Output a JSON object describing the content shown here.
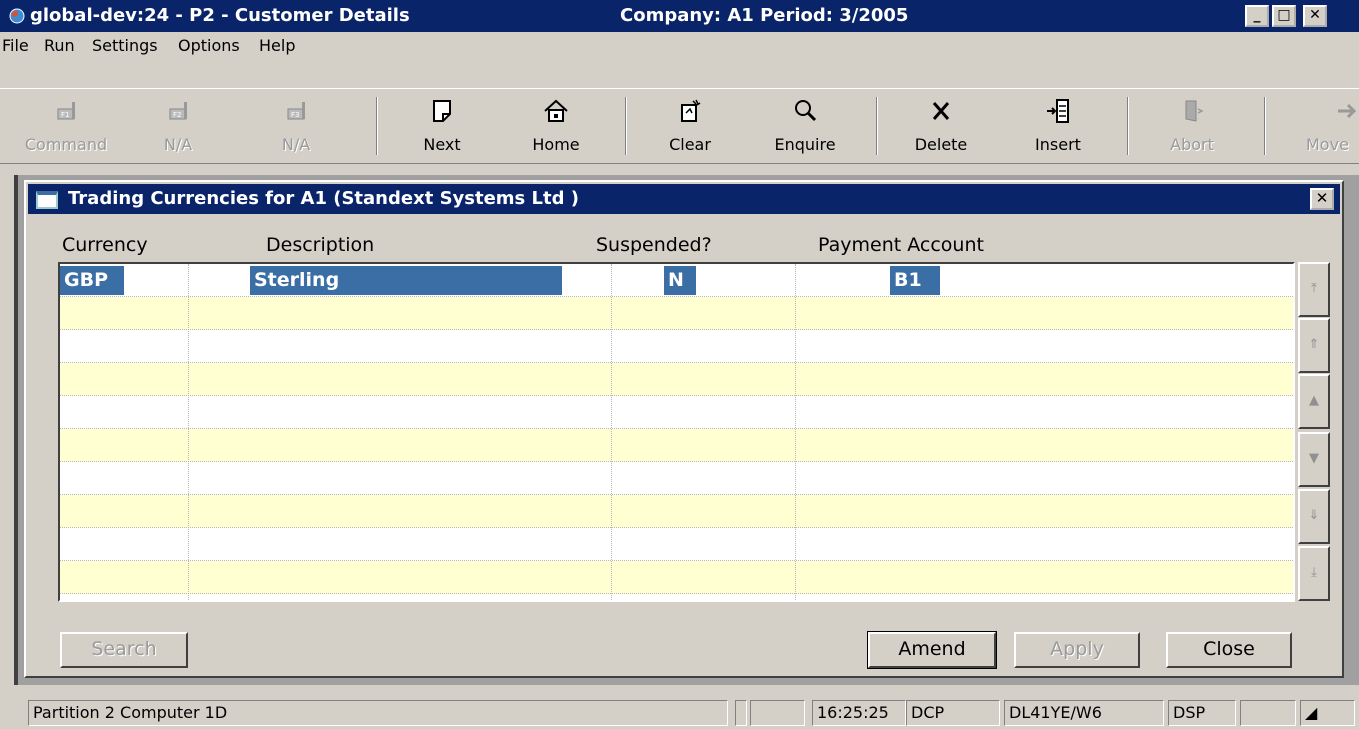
{
  "window": {
    "title": "global-dev:24 - P2 - Customer Details",
    "company_period": "Company: A1  Period: 3/2005"
  },
  "menu": [
    "File",
    "Run",
    "Settings",
    "Options",
    "Help"
  ],
  "toolbar": {
    "buttons": [
      {
        "label": "Command",
        "icon": "f1-key-icon",
        "enabled": false
      },
      {
        "label": "N/A",
        "icon": "f2-key-icon",
        "enabled": false
      },
      {
        "label": "N/A",
        "icon": "f3-key-icon",
        "enabled": false
      },
      {
        "label": "Next",
        "icon": "page-icon",
        "enabled": true
      },
      {
        "label": "Home",
        "icon": "home-icon",
        "enabled": true
      },
      {
        "label": "Clear",
        "icon": "clear-icon",
        "enabled": true
      },
      {
        "label": "Enquire",
        "icon": "magnifier-icon",
        "enabled": true
      },
      {
        "label": "Delete",
        "icon": "x-icon",
        "enabled": true
      },
      {
        "label": "Insert",
        "icon": "insert-icon",
        "enabled": true
      },
      {
        "label": "Abort",
        "icon": "exit-door-icon",
        "enabled": false
      },
      {
        "label": "Move",
        "icon": "arrow-right-icon",
        "enabled": false
      }
    ]
  },
  "dialog": {
    "title": "Trading Currencies for A1 (Standext Systems Ltd )",
    "columns": [
      "Currency",
      "Description",
      "Suspended?",
      "Payment Account"
    ],
    "rows": [
      {
        "currency": "GBP",
        "description": "Sterling",
        "suspended": "N",
        "payment_account": "B1"
      }
    ],
    "buttons": {
      "search": "Search",
      "amend": "Amend",
      "apply": "Apply",
      "close": "Close"
    }
  },
  "statusbar": {
    "partition": "Partition 2 Computer 1D",
    "time": "16:25:25",
    "mode": "DCP",
    "terminal": "DL41YE/W6",
    "display": "DSP"
  },
  "colors": {
    "title_bg": "#0a246a",
    "selection": "#3a6ea5",
    "alt_row": "#ffffd2",
    "face": "#d4d0c8"
  }
}
